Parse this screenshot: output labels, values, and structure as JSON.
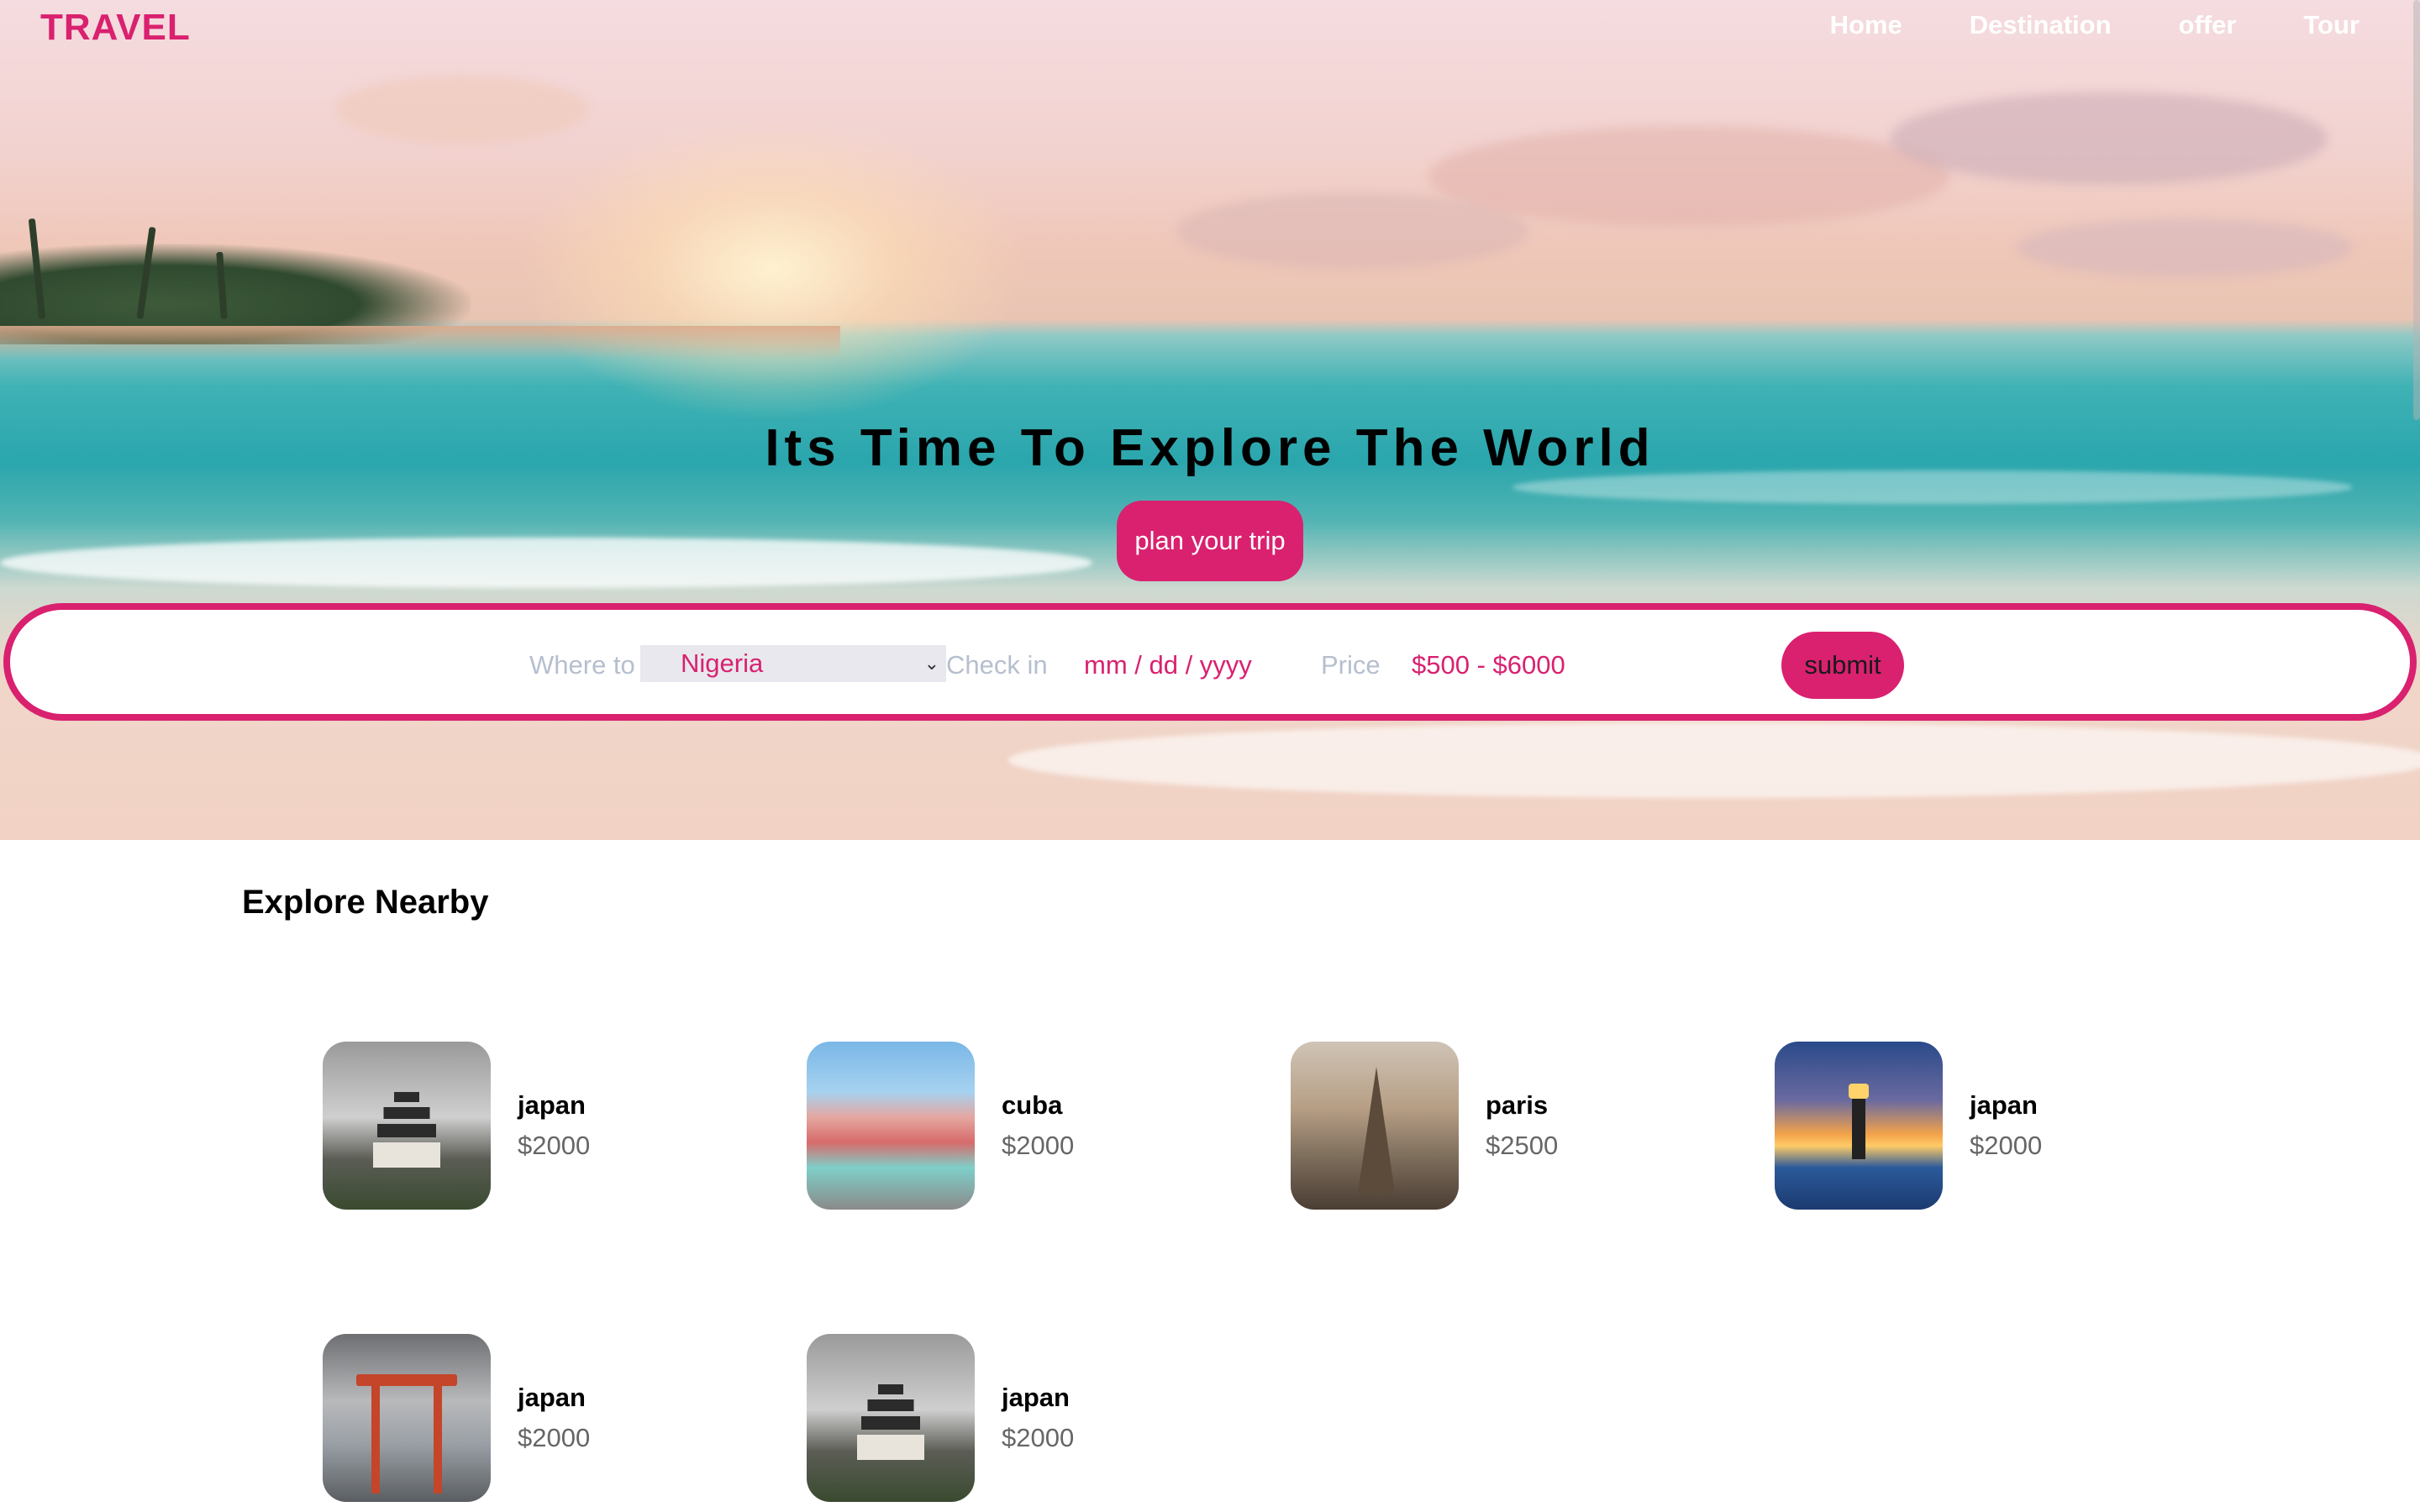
{
  "brand": {
    "logo": "TRAVEL"
  },
  "nav": {
    "items": [
      "Home",
      "Destination",
      "offer",
      "Tour"
    ]
  },
  "hero": {
    "headline": "Its Time To Explore The World",
    "cta": "plan your trip"
  },
  "search": {
    "where_label": "Where to",
    "where_value": "Nigeria",
    "checkin_label": "Check in",
    "checkin_placeholder": "mm / dd / yyyy",
    "price_label": "Price",
    "price_range": "$500 - $6000",
    "submit": "submit"
  },
  "explore": {
    "title": "Explore Nearby",
    "cards": [
      {
        "name": "japan",
        "price": "$2000",
        "image": "castle"
      },
      {
        "name": "cuba",
        "price": "$2000",
        "image": "colorful-street"
      },
      {
        "name": "paris",
        "price": "$2500",
        "image": "eiffel-tower"
      },
      {
        "name": "japan",
        "price": "$2000",
        "image": "lighthouse-sunset"
      },
      {
        "name": "japan",
        "price": "$2000",
        "image": "torii-gate"
      },
      {
        "name": "japan",
        "price": "$2000",
        "image": "castle"
      }
    ]
  },
  "colors": {
    "accent": "#d9216f",
    "nav_text": "#ffffff",
    "muted_label": "#b6bfcf"
  }
}
